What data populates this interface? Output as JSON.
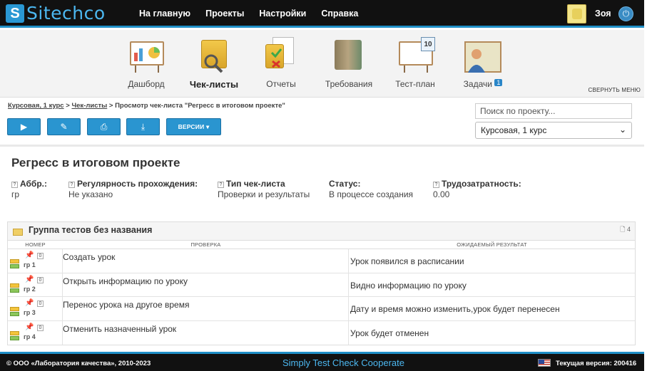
{
  "app": {
    "logo_text": "Sitechco"
  },
  "nav": [
    {
      "label": "На главную"
    },
    {
      "label": "Проекты"
    },
    {
      "label": "Настройки"
    },
    {
      "label": "Справка"
    }
  ],
  "user": {
    "name": "Зоя"
  },
  "modules": [
    {
      "label": "Дашборд",
      "icon": "dashboard-board-icon"
    },
    {
      "label": "Чек-листы",
      "icon": "checklists-folder-icon",
      "active": true
    },
    {
      "label": "Отчеты",
      "icon": "reports-icon"
    },
    {
      "label": "Требования",
      "icon": "requirements-binders-icon"
    },
    {
      "label": "Тест-план",
      "icon": "testplan-calendar-icon",
      "calendar_day": "10"
    },
    {
      "label": "Задачи",
      "icon": "tasks-person-icon",
      "badge": "1"
    }
  ],
  "collapse_menu": "СВЕРНУТЬ МЕНЮ",
  "breadcrumb": {
    "crumb1": "Курсовая, 1 курс",
    "sep": ">",
    "crumb2": "Чек-листы",
    "current": "Просмотр чек-листа \"Регресс в итоговом проекте\""
  },
  "toolbar": {
    "run_icon": "▶",
    "edit_icon": "✎",
    "print_icon": "⎙",
    "download_icon": "⤓",
    "versions_label": "ВЕРСИИ ▾"
  },
  "search": {
    "placeholder": "Поиск по проекту..."
  },
  "project_select": {
    "value": "Курсовая, 1 курс"
  },
  "checklist": {
    "title": "Регресс в итоговом проекте",
    "props": [
      {
        "name": "Аббр.:",
        "value": "гр",
        "help": true
      },
      {
        "name": "Регулярность прохождения:",
        "value": "Не указано",
        "help": true
      },
      {
        "name": "Тип чек-листа",
        "value": "Проверки и результаты",
        "help": true
      },
      {
        "name": "Статус:",
        "value": "В процессе создания",
        "help": false
      },
      {
        "name": "Трудозатратность:",
        "value": "0.00",
        "help": true
      }
    ]
  },
  "group": {
    "title": "Группа тестов без названия",
    "count": "4",
    "columns": [
      "НОМЕР",
      "ПРОВЕРКА",
      "ОЖИДАЕМЫЙ РЕЗУЛЬТАТ"
    ],
    "rows": [
      {
        "num": "гр 1",
        "comments": "0",
        "check": "Создать урок",
        "result": "Урок появился в расписании"
      },
      {
        "num": "гр 2",
        "comments": "0",
        "check": "Открыть информацию по уроку",
        "result": "Видно информацию по уроку"
      },
      {
        "num": "гр 3",
        "comments": "0",
        "check": "Перенос урока на другое время",
        "result": "Дату и время можно изменить,урок будет перенесен"
      },
      {
        "num": "гр 4",
        "comments": "0",
        "check": "Отменить назначенный урок",
        "result": "Урок будет отменен"
      }
    ]
  },
  "footer": {
    "copyright": "© ООО «Лаборатория качества», 2010-2023",
    "slogan": "Simply Test Check Cooperate",
    "version": "Текущая версия: 200416"
  },
  "colors": {
    "accent": "#2a95d0",
    "topbar": "#111111",
    "logo": "#4cb7f0"
  }
}
